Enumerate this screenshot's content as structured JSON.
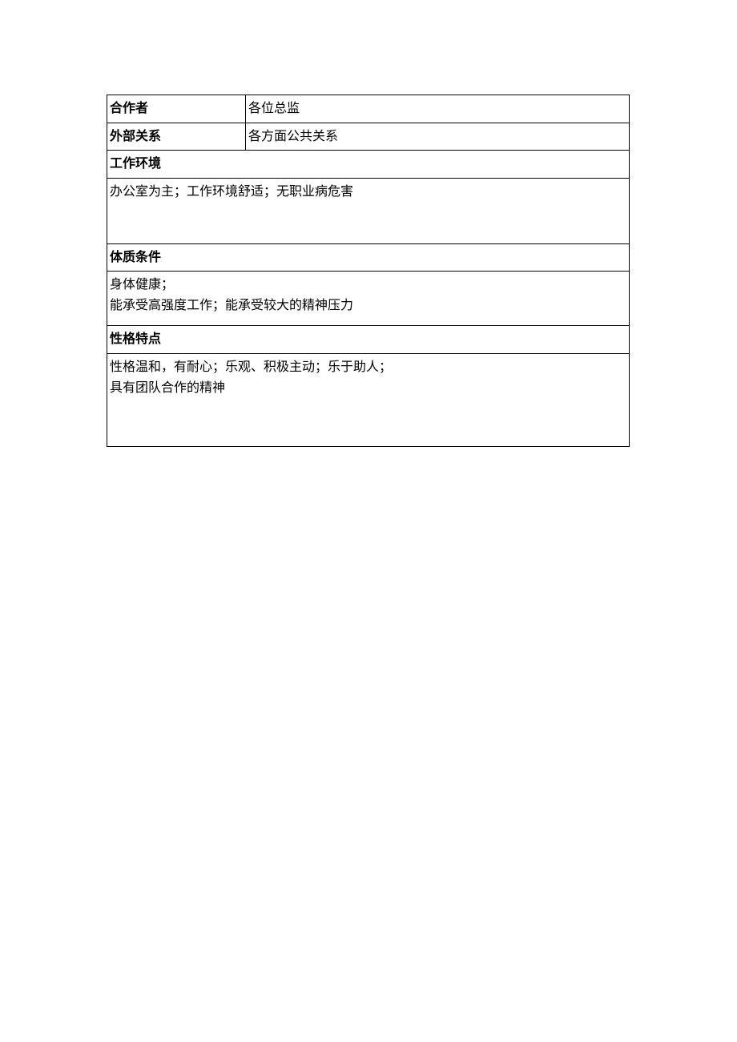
{
  "rows": {
    "collaborator": {
      "label": "合作者",
      "value": "各位总监"
    },
    "external_relations": {
      "label": "外部关系",
      "value": "各方面公共关系"
    },
    "work_environment": {
      "header": "工作环境",
      "content": "办公室为主；工作环境舒适；无职业病危害"
    },
    "physical_conditions": {
      "header": "体质条件",
      "content": "身体健康；\n能承受高强度工作；能承受较大的精神压力"
    },
    "personality": {
      "header": "性格特点",
      "content": "性格温和，有耐心；乐观、积极主动；乐于助人；\n具有团队合作的精神"
    }
  }
}
